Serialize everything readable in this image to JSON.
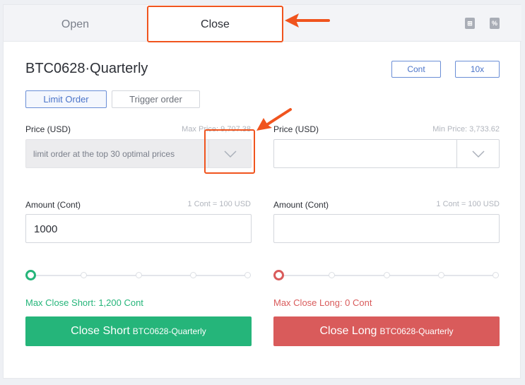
{
  "tabs": {
    "open_label": "Open",
    "close_label": "Close"
  },
  "tools": {
    "calculator_glyph": "⊞",
    "percent_glyph": "%"
  },
  "header": {
    "title": "BTC0628·Quarterly",
    "unit_button": "Cont",
    "leverage_button": "10x"
  },
  "order_types": {
    "limit": "Limit Order",
    "trigger": "Trigger order"
  },
  "left": {
    "price_label": "Price (USD)",
    "price_hint": "Max Price: 9,707.38",
    "price_select_text": "limit order at the top 30 optimal prices",
    "amount_label": "Amount (Cont)",
    "amount_hint": "1 Cont = 100 USD",
    "amount_value": "1000",
    "slider_level": 0,
    "max_text": "Max Close Short: 1,200 Cont",
    "action_main": "Close Short",
    "action_sub": "BTC0628-Quarterly"
  },
  "right": {
    "price_label": "Price (USD)",
    "price_hint": "Min Price: 3,733.62",
    "price_value": "",
    "amount_label": "Amount (Cont)",
    "amount_hint": "1 Cont = 100 USD",
    "amount_value": "",
    "slider_level": 0,
    "max_text": "Max Close Long: 0 Cont",
    "action_main": "Close Long",
    "action_sub": "BTC0628-Quarterly"
  },
  "colors": {
    "buy_green": "#25b57a",
    "sell_red": "#d95b5b",
    "annotation_orange": "#f0541e",
    "accent_blue": "#4b74c9"
  }
}
